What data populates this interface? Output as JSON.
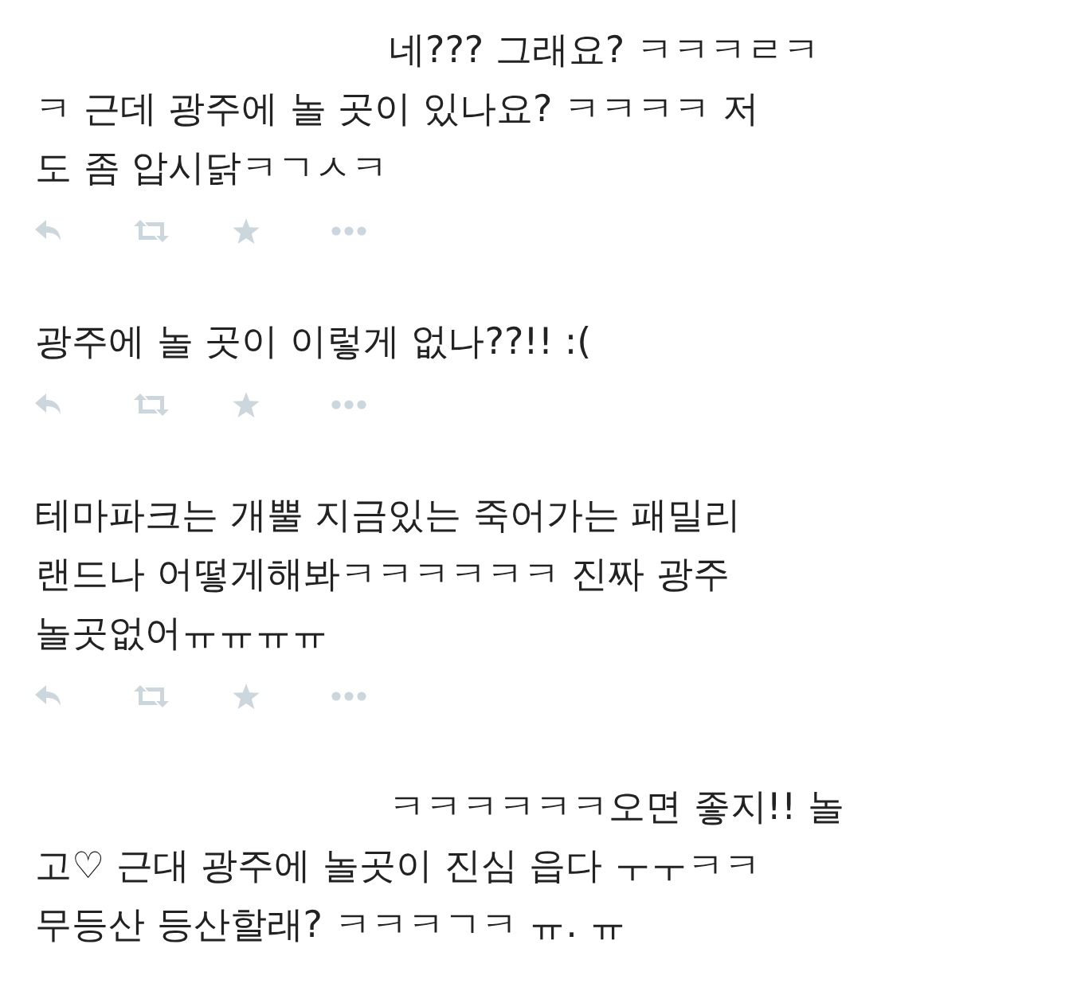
{
  "tweets": [
    {
      "kind": "reply",
      "lines": [
        "네??? 그래요? ㅋㅋㅋㄹㅋ",
        "ㅋ 근데 광주에 놀 곳이 있나요? ㅋㅋㅋㅋ 저",
        "도 좀 압시닭ㅋㄱㅅㅋ"
      ],
      "actions": true
    },
    {
      "kind": "plain",
      "lines": [
        "광주에 놀 곳이 이렇게 없나??!! :("
      ],
      "actions": true
    },
    {
      "kind": "plain",
      "lines": [
        "테마파크는 개뿔 지금있는 죽어가는 패밀리",
        "랜드나 어떻게해봐ㅋㅋㅋㅋㅋㅋ 진짜 광주",
        "놀곳없어ㅠㅠㅠㅠ"
      ],
      "actions": true
    },
    {
      "kind": "reply",
      "lines": [
        "ㅋㅋㅋㅋㅋㅋ오면 좋지!! 놀",
        "고♡ 근대 광주에 놀곳이 진심 읍다 ㅜㅜㅋㅋ",
        "무등산 등산할래? ㅋㅋㅋㄱㅋ ㅠ. ㅠ"
      ],
      "actions": false
    }
  ]
}
